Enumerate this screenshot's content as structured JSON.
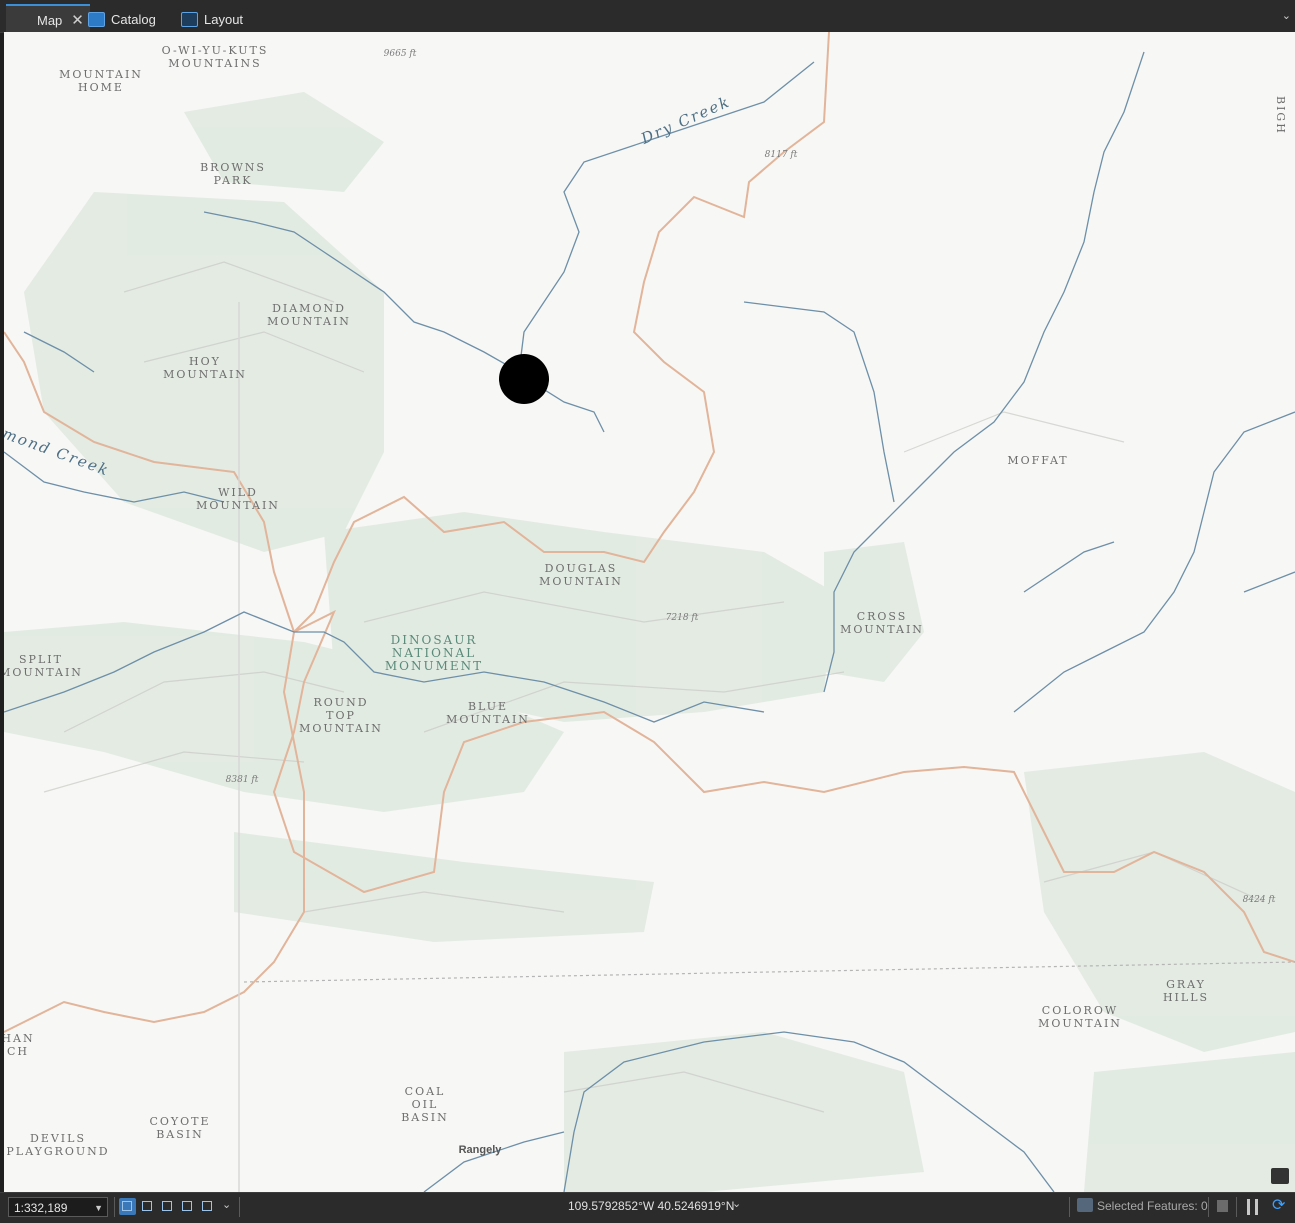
{
  "tabs": [
    {
      "label": "Map",
      "icon": "map-icon",
      "active": true,
      "closable": true
    },
    {
      "label": "Catalog",
      "icon": "catalog-icon",
      "active": false
    },
    {
      "label": "Layout",
      "icon": "layout-icon",
      "active": false
    }
  ],
  "map": {
    "labels": {
      "owiyukuts": "O-WI-YU-KUTS\nMOUNTAINS",
      "mountain_home": "MOUNTAIN\nHOME",
      "browns_park": "BROWNS\nPARK",
      "diamond_mountain": "DIAMOND\nMOUNTAIN",
      "hoy_mountain": "HOY\nMOUNTAIN",
      "wild_mountain": "WILD\nMOUNTAIN",
      "douglas_mountain": "DOUGLAS\nMOUNTAIN",
      "dinosaur": "DINOSAUR\nNATIONAL\nMONUMENT",
      "split_mountain": "SPLIT\nMOUNTAIN",
      "round_top": "ROUND\nTOP\nMOUNTAIN",
      "blue_mountain": "BLUE\nMOUNTAIN",
      "cross_mountain": "CROSS\nMOUNTAIN",
      "moffat": "MOFFAT",
      "gray_hills": "GRAY\nHILLS",
      "colorow": "COLOROW\nMOUNTAIN",
      "coal_oil": "COAL\nOIL\nBASIN",
      "coyote": "COYOTE\nBASIN",
      "devils": "DEVILS\nPLAYGROUND",
      "rangely": "Rangely",
      "dry_creek": "Dry Creek",
      "diamond_creek": "mond Creek",
      "bigh": "BIGH",
      "han": "HAN\nCH",
      "elev_9665": "9665 ft",
      "elev_8117": "8117 ft",
      "elev_7218": "7218 ft",
      "elev_8381": "8381 ft",
      "elev_8424": "8424 ft"
    },
    "colors": {
      "background": "#f7f7f5",
      "boundary": "#e2b49a",
      "river": "#6d8fa8",
      "terrain_green": "#dfe9df",
      "marker": "#000000"
    }
  },
  "status": {
    "scale": "1:332,189",
    "coordinates": "109.5792852°W 40.5246919°N",
    "selected_features": "Selected Features: 0"
  }
}
